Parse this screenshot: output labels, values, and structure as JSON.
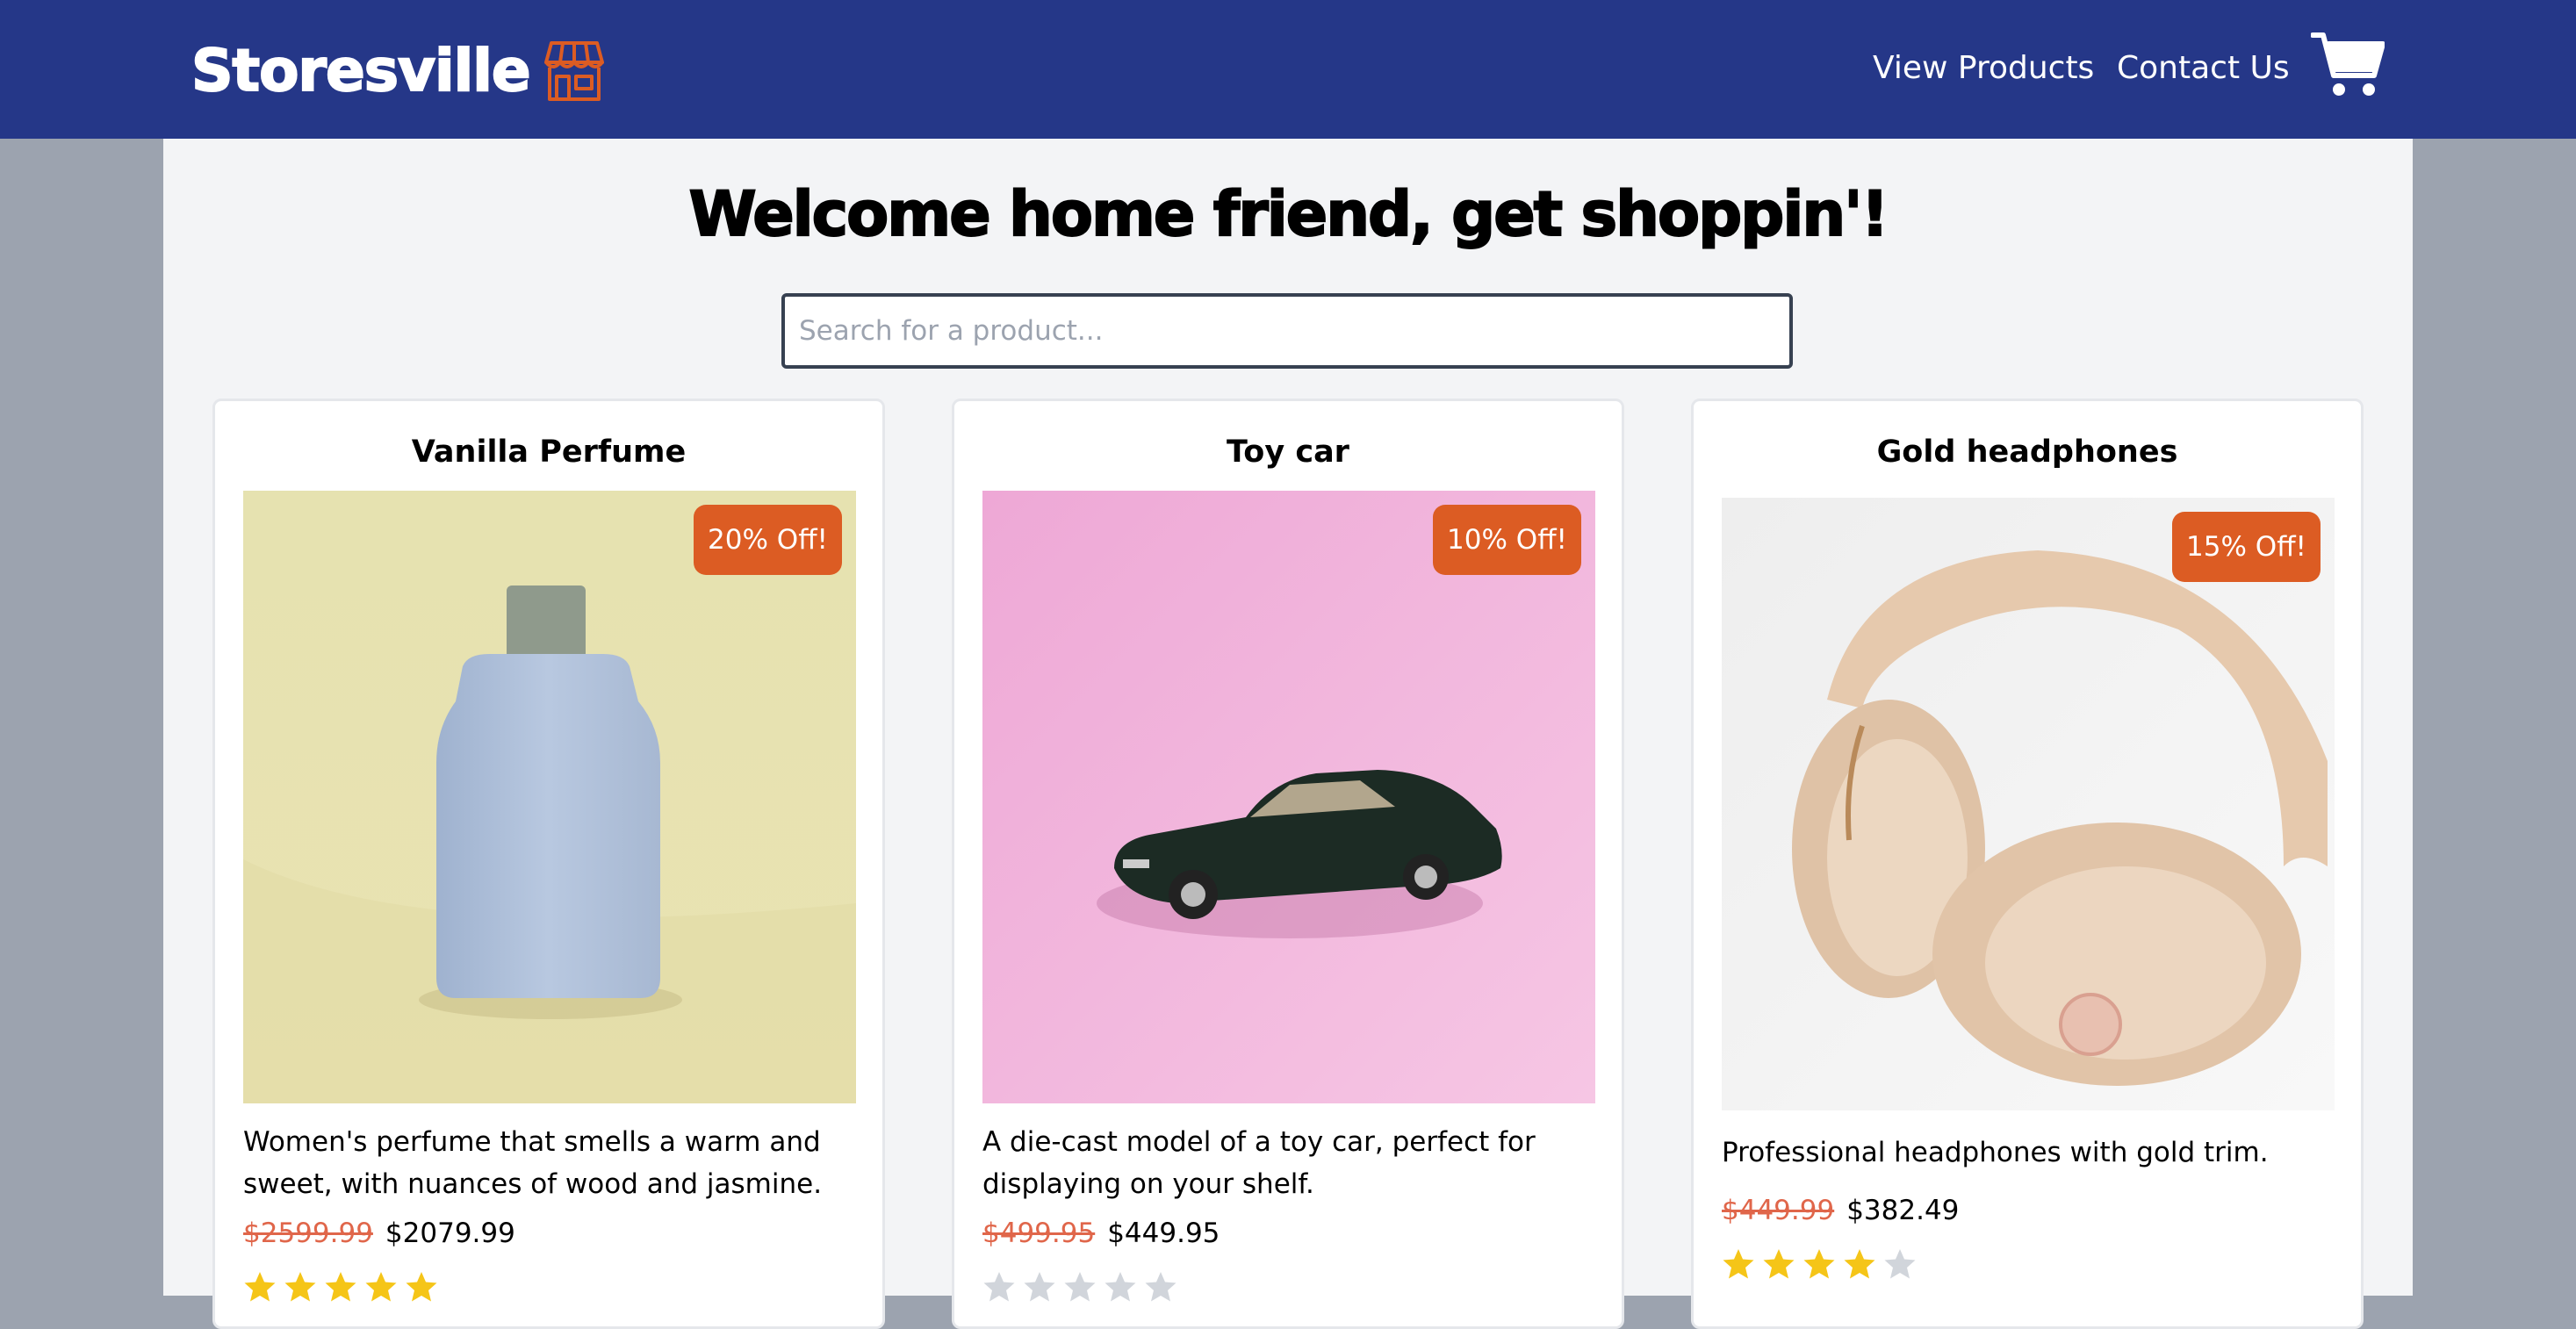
{
  "brand": {
    "name": "Storesville",
    "icon": "storefront-icon"
  },
  "nav": {
    "links": [
      "View Products",
      "Contact Us"
    ],
    "cart_icon": "shopping-cart-icon"
  },
  "main": {
    "headline": "Welcome home friend, get shoppin'!",
    "search": {
      "placeholder": "Search for a product...",
      "value": ""
    }
  },
  "colors": {
    "navbar": "#253788",
    "accent": "#dc5c23",
    "star_filled": "#f5c518",
    "star_empty": "#d1d5db",
    "old_price": "#e0664a"
  },
  "products": [
    {
      "title": "Vanilla Perfume",
      "discount": "20% Off!",
      "description": "Women's perfume that smells a warm and sweet, with nuances of wood and jasmine.",
      "old_price": "$2599.99",
      "price": "$2079.99",
      "rating": 5,
      "image": "perfume-bottle-image"
    },
    {
      "title": "Toy car",
      "discount": "10% Off!",
      "description": "A die-cast model of a toy car, perfect for displaying on your shelf.",
      "old_price": "$499.95",
      "price": "$449.95",
      "rating": 0,
      "image": "toy-car-image"
    },
    {
      "title": "Gold headphones",
      "discount": "15% Off!",
      "description": "Professional headphones with gold trim.",
      "old_price": "$449.99",
      "price": "$382.49",
      "rating": 4,
      "image": "headphones-image"
    }
  ]
}
